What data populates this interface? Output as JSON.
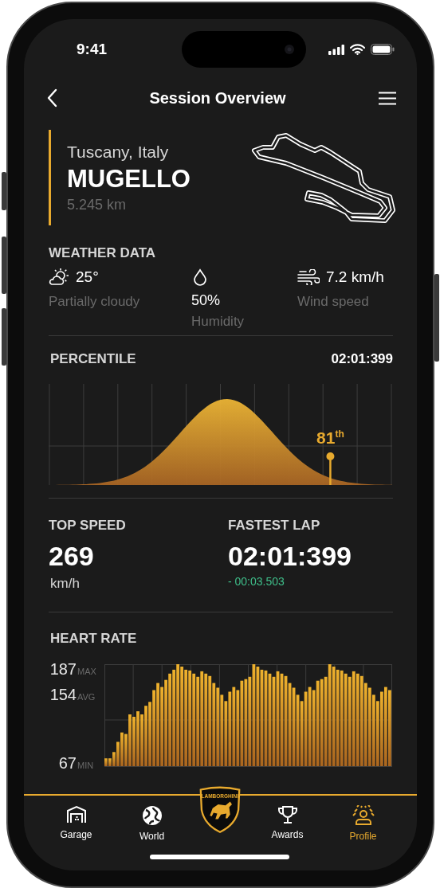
{
  "status_bar": {
    "time": "9:41"
  },
  "header": {
    "title": "Session Overview"
  },
  "track": {
    "region": "Tuscany, Italy",
    "name": "MUGELLO",
    "length": "5.245 km"
  },
  "weather": {
    "title": "WEATHER DATA",
    "items": [
      {
        "kind": "temperature",
        "value": "25°",
        "label": "Partially cloudy"
      },
      {
        "kind": "humidity",
        "value": "50%",
        "label": "Humidity"
      },
      {
        "kind": "wind",
        "value": "7.2 km/h",
        "label": "Wind speed"
      }
    ]
  },
  "percentile": {
    "title": "PERCENTILE",
    "time": "02:01:399",
    "marker": "81$^{th}$",
    "level": 0.82
  },
  "stats": [
    {
      "title": "TOP SPEED",
      "value": "269",
      "unit": "km/h"
    },
    {
      "title": "FASTEST LAP",
      "value": "02:01:399",
      "delta": "- 00:03.503"
    }
  ],
  "heart_rate": {
    "title": "HEART RATE",
    "tick_notes": [
      "MAX",
      "AVG",
      "MIN"
    ],
    "chart_data": {
      "type": "bar",
      "grid": true,
      "ylim": [
        57,
        187
      ],
      "yticks": [
        {
          "value": 187,
          "label": "187"
        },
        {
          "value": 154,
          "label": "154"
        },
        {
          "value": 67,
          "label": "67"
        }
      ],
      "values": [
        67,
        67,
        75,
        88,
        100,
        98,
        123,
        120,
        127,
        123,
        134,
        139,
        154,
        163,
        158,
        167,
        175,
        180,
        187,
        184,
        180,
        179,
        175,
        171,
        178,
        175,
        172,
        163,
        157,
        148,
        140,
        152,
        158,
        154,
        166,
        168,
        171,
        187,
        184,
        180,
        179,
        175,
        171,
        178,
        175,
        172,
        163,
        157,
        148,
        140,
        152,
        158,
        154,
        166,
        168,
        171,
        187,
        184,
        180,
        179,
        175,
        171,
        178,
        175,
        172,
        163,
        157,
        148,
        140,
        152,
        158,
        154
      ]
    }
  },
  "tab_bar": {
    "logo_text": "LAMBORGHINI",
    "tabs": [
      {
        "label": "Garage",
        "selected": false
      },
      {
        "label": "World",
        "selected": false
      },
      {
        "label": "Awards",
        "selected": false
      },
      {
        "label": "Profile",
        "selected": true
      }
    ]
  }
}
